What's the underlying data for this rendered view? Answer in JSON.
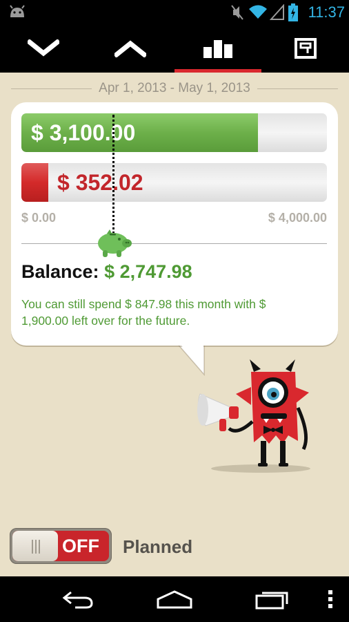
{
  "status_bar": {
    "time": "11:37",
    "icons": [
      "android-icon",
      "mute-icon",
      "wifi-icon",
      "signal-icon",
      "battery-icon"
    ],
    "clock_color": "#33b5e5"
  },
  "tabs": [
    {
      "icon": "chevron-down-icon",
      "active": false
    },
    {
      "icon": "chevron-up-icon",
      "active": false
    },
    {
      "icon": "bar-chart-icon",
      "active": true
    },
    {
      "icon": "register-icon",
      "active": false
    }
  ],
  "date_range": "Apr 1, 2013 - May 1, 2013",
  "summary": {
    "income_amount": "$ 3,100.00",
    "expense_amount": "$ 352.02",
    "axis_min": "$ 0.00",
    "axis_max": "$ 4,000.00",
    "income_fraction": 0.775,
    "expense_fraction": 0.088,
    "marker_fraction": 0.31,
    "balance_label": "Balance:",
    "balance_value": "$ 2,747.98",
    "message": "You can still spend $ 847.98 this month with $ 1,900.00 left over for the future."
  },
  "toggle": {
    "state": "OFF",
    "label": "Planned"
  },
  "colors": {
    "accent": "#d9282e",
    "income": "#6db04a",
    "expense": "#d42a2a",
    "positive_text": "#4f9a34",
    "background": "#e9e0c8"
  },
  "nav": [
    "back-icon",
    "home-icon",
    "recent-apps-icon",
    "overflow-menu-icon"
  ]
}
